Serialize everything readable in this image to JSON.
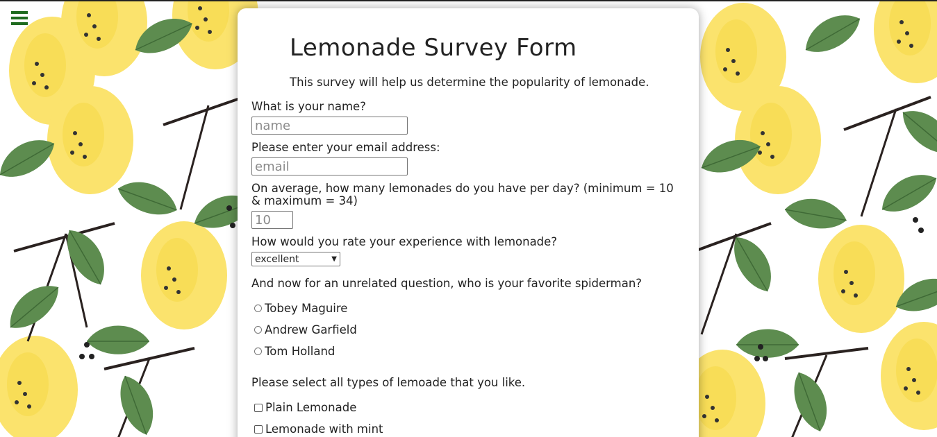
{
  "form": {
    "title": "Lemonade Survey Form",
    "description": "This survey will help us determine the popularity of lemonade.",
    "name_question": "What is your name?",
    "name_placeholder": "name",
    "email_question": "Please enter your email address:",
    "email_placeholder": "email",
    "count_question": "On average, how many lemonades do you have per day? (minimum = 10 & maximum = 34)",
    "count_value": "10",
    "rating_question": "How would you rate your experience with lemonade?",
    "rating_selected": "excellent",
    "spiderman_question": "And now for an unrelated question, who is your favorite spiderman?",
    "spiderman_options": [
      "Tobey Maguire",
      "Andrew Garfield",
      "Tom Holland"
    ],
    "lemonade_question": "Please select all types of lemoade that you like.",
    "lemonade_options": [
      "Plain Lemonade",
      "Lemonade with mint"
    ]
  },
  "colors": {
    "lemon": "#fbe36d",
    "lemon_dark": "#f3cf3a",
    "leaf": "#5d8c4f",
    "leaf_dark": "#3f6a36",
    "branch": "#2a2220",
    "menu_icon": "#1f6b1f"
  },
  "icons": {
    "menu": "hamburger-menu-icon",
    "dropdown": "chevron-down-icon"
  }
}
